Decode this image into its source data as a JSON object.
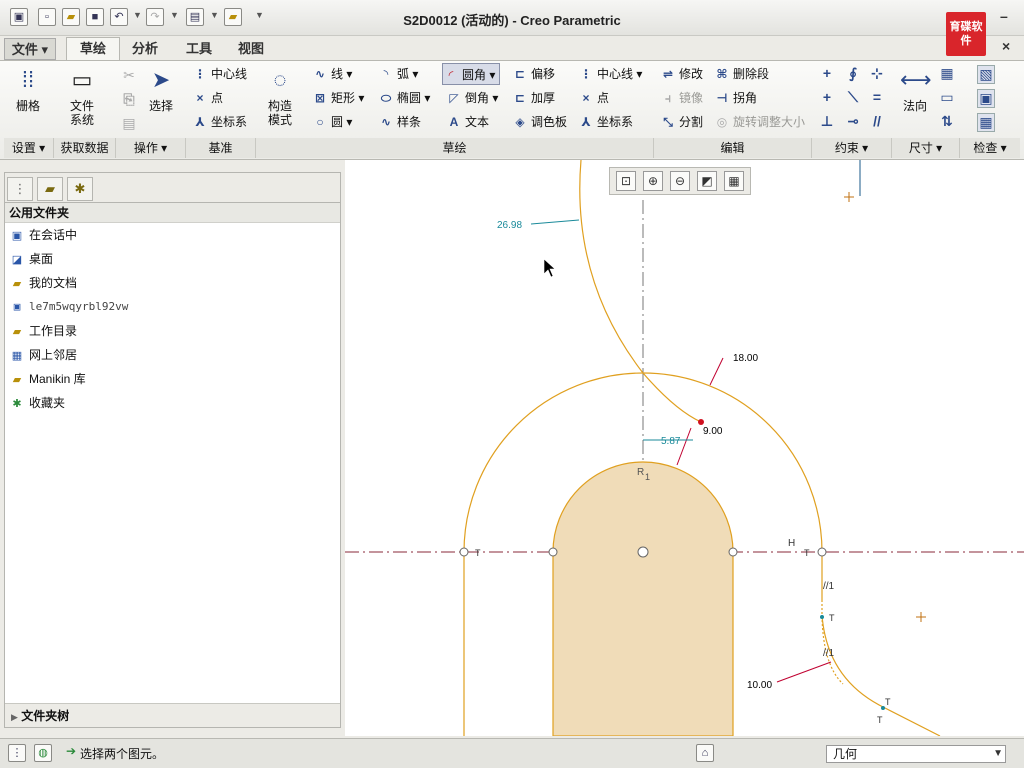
{
  "window": {
    "title": "S2D0012 (活动的) - Creo Parametric",
    "logo_text": "育碟软件",
    "controls": [
      "–",
      "×"
    ]
  },
  "menu_tabs": [
    "文件",
    "草绘",
    "分析",
    "工具",
    "视图"
  ],
  "ribbon": {
    "setup": {
      "grid": "栅格"
    },
    "getdata": {
      "filesystem_l1": "文件",
      "filesystem_l2": "系统"
    },
    "operations": {
      "select": "选择"
    },
    "datum": {
      "centerline": "中心线",
      "point": "点",
      "coord": "坐标系"
    },
    "construct": {
      "l1": "构造",
      "l2": "模式"
    },
    "sketch": {
      "line": "线",
      "arc": "弧",
      "fillet": "圆角",
      "offset": "偏移",
      "rect": "矩形",
      "ellipse": "椭圆",
      "chamfer": "倒角",
      "thicken": "加厚",
      "circle": "圆",
      "spline": "样条",
      "text": "文本",
      "palette": "调色板",
      "centerline": "中心线",
      "point": "点",
      "coord": "坐标系"
    },
    "edit": {
      "modify": "修改",
      "delete_seg": "删除段",
      "mirror": "镜像",
      "corner": "拐角",
      "divide": "分割",
      "rotate_resize": "旋转调整大小"
    },
    "dimension": {
      "normal": "法向"
    },
    "groups": [
      "设置",
      "获取数据",
      "操作",
      "基准",
      "草绘",
      "编辑",
      "约束",
      "尺寸",
      "检查"
    ]
  },
  "left_panel": {
    "header": "公用文件夹",
    "items": [
      "在会话中",
      "桌面",
      "我的文档",
      "le7m5wqyrbl92vw",
      "工作目录",
      "网上邻居",
      "Manikin 库",
      "收藏夹"
    ],
    "footer": "文件夹树"
  },
  "sketch": {
    "dims": {
      "d1": "26.98",
      "d2": "18.00",
      "d3": "9.00",
      "d4": "5.87",
      "d5": "10.00"
    },
    "labels": {
      "r1": "R",
      "r1_sub": "1",
      "h": "H",
      "t": "T",
      "par1": "//1",
      "par2": "//1"
    }
  },
  "status": {
    "message": "选择两个图元。",
    "filter": "几何"
  },
  "colors": {
    "curve": "#e0a020",
    "fill": "#f0dcb8",
    "dim": "#1a8a9a",
    "dim_red": "#c00030",
    "centerline": "#888888",
    "arc_dim": "#000000"
  }
}
